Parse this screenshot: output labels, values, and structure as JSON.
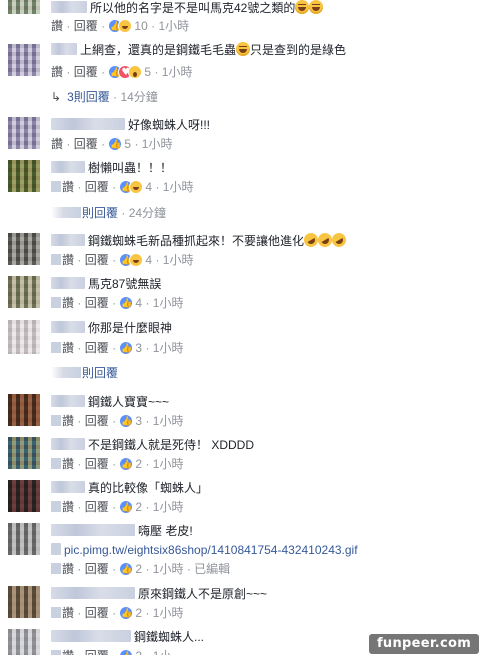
{
  "common": {
    "like_label": "讚",
    "reply_label": "回覆",
    "dot": "·"
  },
  "comments": [
    {
      "text": "所以他的名字是不是叫馬克42號之類的",
      "count": "10",
      "time": "1小時",
      "emoji": "laugh-emoji",
      "reactions": [
        "like",
        "haha"
      ]
    },
    {
      "text": "上網查，還真的是鋼鐵毛毛蟲",
      "text2": "只是查到的是綠色",
      "count": "5",
      "time": "1小時",
      "reactions": [
        "like",
        "love",
        "wow"
      ]
    },
    {
      "text": "好像蜘蛛人呀!!!",
      "count": "5",
      "time": "1小時",
      "reactions": [
        "like"
      ]
    },
    {
      "text": "樹懶叫蟲！！！",
      "count": "4",
      "time": "1小時",
      "reactions": [
        "like",
        "haha"
      ]
    },
    {
      "text": "鋼鐵蜘蛛毛新品種抓起來！不要讓他進化",
      "count": "4",
      "time": "1小時",
      "reactions": [
        "like",
        "haha"
      ]
    },
    {
      "text": "馬克87號無誤",
      "count": "4",
      "time": "1小時",
      "reactions": [
        "like"
      ]
    },
    {
      "text": "你那是什麼眼神",
      "count": "3",
      "time": "1小時",
      "reactions": [
        "like"
      ]
    },
    {
      "text": "鋼鐵人寶寶~~~",
      "count": "3",
      "time": "1小時",
      "reactions": [
        "like"
      ]
    },
    {
      "text": "不是鋼鐵人就是死侍！ XDDDD",
      "count": "2",
      "time": "1小時",
      "reactions": [
        "like"
      ]
    },
    {
      "text": "真的比較像「蜘蛛人」",
      "count": "2",
      "time": "1小時",
      "reactions": [
        "like"
      ]
    },
    {
      "text": "嗨壓 老皮!",
      "text2": "pic.pimg.tw/eightsix86shop/1410841754-432410243.gif",
      "count": "2",
      "time": "1小時",
      "edited": "已編輯",
      "reactions": [
        "like"
      ]
    },
    {
      "text": "原來鋼鐵人不是原創~~~",
      "count": "2",
      "time": "1小時",
      "reactions": [
        "like"
      ]
    },
    {
      "text": "鋼鐵蜘蛛人...",
      "count": "2",
      "time": "1小",
      "reactions": [
        "like"
      ]
    }
  ],
  "reply_threads": [
    {
      "label": "3則回覆",
      "age": "14分鐘"
    },
    {
      "label": "則回覆",
      "age": "24分鐘"
    },
    {
      "label": "則回覆",
      "age": ""
    }
  ],
  "watermark": "funpeer.com"
}
